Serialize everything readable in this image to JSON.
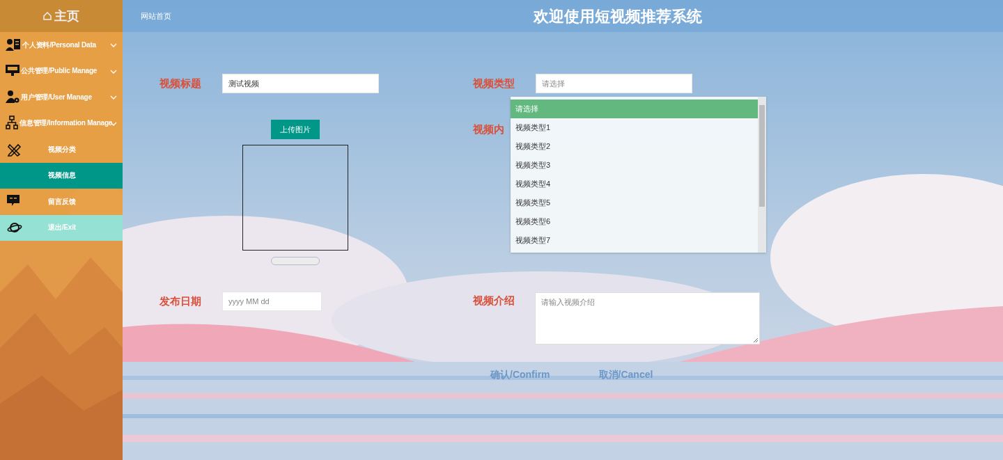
{
  "sidebar": {
    "home": "主页",
    "items": [
      {
        "label": "个人资料/Personal Data",
        "kind": "group",
        "selected": false
      },
      {
        "label": "公共管理/Public Manage",
        "kind": "group",
        "selected": false
      },
      {
        "label": "用户管理/User Manage",
        "kind": "group",
        "selected": false
      },
      {
        "label": "信息管理/Information Manage",
        "kind": "group",
        "selected": false
      },
      {
        "label": "视频分类",
        "kind": "child",
        "selected": false
      },
      {
        "label": "视频信息",
        "kind": "child",
        "selected": true
      },
      {
        "label": "留言反馈",
        "kind": "child",
        "selected": false
      },
      {
        "label": "退出/Exit",
        "kind": "exit",
        "selected": false
      }
    ]
  },
  "header": {
    "breadcrumb": "网站首页",
    "title": "欢迎使用短视频推荐系统"
  },
  "form": {
    "title_label": "视频标题",
    "title_value": "测试视频",
    "type_label": "视频类型",
    "type_value": "请选择",
    "upload_button": "上传图片",
    "content_label": "视频内",
    "date_label": "发布日期",
    "date_placeholder": "yyyy MM dd",
    "intro_label": "视频介绍",
    "intro_placeholder": "请输入视频介绍",
    "type_options": [
      {
        "label": "请选择",
        "selected": true
      },
      {
        "label": "视频类型1",
        "selected": false
      },
      {
        "label": "视频类型2",
        "selected": false
      },
      {
        "label": "视频类型3",
        "selected": false
      },
      {
        "label": "视频类型4",
        "selected": false
      },
      {
        "label": "视频类型5",
        "selected": false
      },
      {
        "label": "视频类型6",
        "selected": false
      },
      {
        "label": "视频类型7",
        "selected": false
      }
    ]
  },
  "buttons": [
    "确认/Confirm",
    "取消/Cancel"
  ]
}
